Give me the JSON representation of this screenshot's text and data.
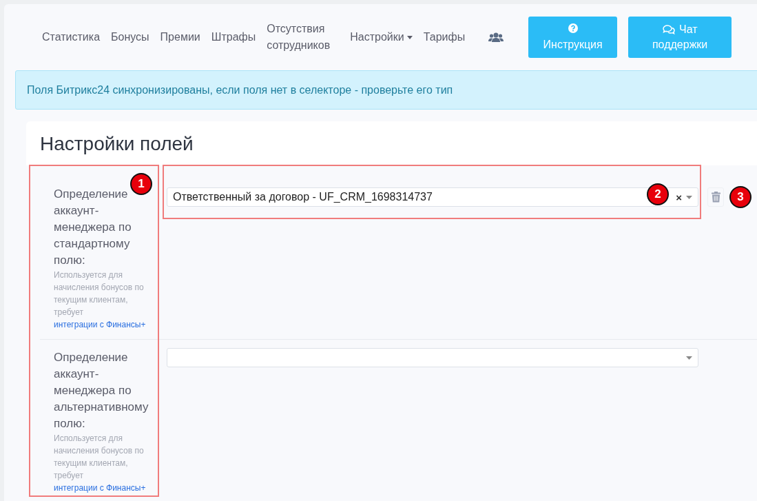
{
  "nav": {
    "items": [
      {
        "label": "Статистика",
        "kind": "link"
      },
      {
        "label": "Бонусы",
        "kind": "link"
      },
      {
        "label": "Премии",
        "kind": "link"
      },
      {
        "label": "Штрафы",
        "kind": "link"
      },
      {
        "label": "Отсутствия сотрудников",
        "kind": "link"
      },
      {
        "label": "Настройки",
        "kind": "dropdown"
      },
      {
        "label": "Тарифы",
        "kind": "link"
      },
      {
        "kind": "users-icon"
      }
    ],
    "buttons": [
      {
        "label": "Инструкция"
      },
      {
        "label": "Чат поддержки"
      }
    ]
  },
  "alert": {
    "text": "Поля Битрикс24 синхронизированы, если поля нет в селекторе - проверьте его тип"
  },
  "card": {
    "title": "Настройки полей",
    "rows": [
      {
        "label": "Определение аккаунт-менеджера по стандартному полю:",
        "help": "Используется для начисления бонусов по текущим клиентам, требует ",
        "help_link": "интеграции с Финансы+",
        "value": "Ответственный за договор - UF_CRM_1698314737",
        "clear_glyph": "×",
        "removable": true
      },
      {
        "label": "Определение аккаунт-менеджера по альтернативному полю:",
        "help": "Используется для начисления бонусов по текущим клиентам, требует ",
        "help_link": "интеграции с Финансы+",
        "removable": false
      }
    ]
  },
  "annotations": [
    {
      "number": "1"
    },
    {
      "number": "2"
    },
    {
      "number": "3"
    }
  ]
}
